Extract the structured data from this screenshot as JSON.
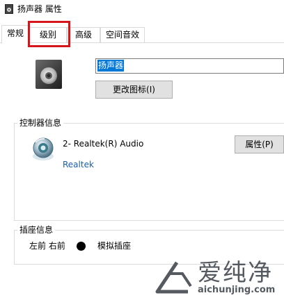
{
  "window": {
    "title": "扬声器 属性"
  },
  "tabs": [
    {
      "label": "常规"
    },
    {
      "label": "级别"
    },
    {
      "label": "高级"
    },
    {
      "label": "空间音效"
    }
  ],
  "general": {
    "device_name_value": "扬声器",
    "change_icon_label": "更改图标(I)"
  },
  "controller": {
    "group_label": "控制器信息",
    "device": "2- Realtek(R) Audio",
    "vendor": "Realtek",
    "properties_label": "属性(P)"
  },
  "jack": {
    "group_label": "插座信息",
    "position": "左前 右前",
    "type": "模拟插座"
  },
  "watermark": {
    "brand_cn": "爱纯净",
    "brand_en": "aichunjing.com"
  },
  "colors": {
    "highlight": "#d5151b",
    "selection": "#0078d7",
    "link": "#1a5fa8"
  }
}
